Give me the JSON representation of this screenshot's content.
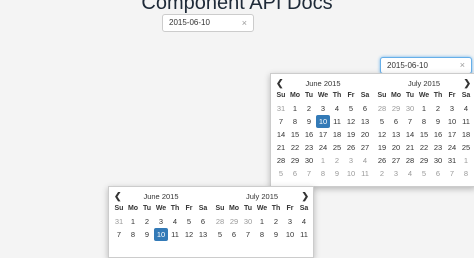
{
  "page": {
    "title": "Component API Docs"
  },
  "input_top": {
    "value": "2015-06-10",
    "clear": "×"
  },
  "input_right": {
    "value": "2015-06-10",
    "clear": "×"
  },
  "weekdays": [
    "Su",
    "Mo",
    "Tu",
    "We",
    "Th",
    "Fr",
    "Sa"
  ],
  "popup1": {
    "prev": "❮",
    "next": "❯",
    "left": {
      "title": "June 2015",
      "days": [
        "31",
        "1",
        "2",
        "3",
        "4",
        "5",
        "6",
        "7",
        "8",
        "9",
        "10",
        "11",
        "12",
        "13",
        "14",
        "15",
        "16",
        "17",
        "18",
        "19",
        "20",
        "21",
        "22",
        "23",
        "24",
        "25",
        "26",
        "27",
        "28",
        "29",
        "30",
        "1",
        "2",
        "3",
        "4",
        "5",
        "6",
        "7",
        "8",
        "9",
        "10",
        "11"
      ],
      "muted": [
        0,
        31,
        32,
        33,
        34,
        35,
        36,
        37,
        38,
        39,
        40,
        41
      ],
      "selected": 10
    },
    "right": {
      "title": "July 2015",
      "days": [
        "28",
        "29",
        "30",
        "1",
        "2",
        "3",
        "4",
        "5",
        "6",
        "7",
        "8",
        "9",
        "10",
        "11",
        "12",
        "13",
        "14",
        "15",
        "16",
        "17",
        "18",
        "19",
        "20",
        "21",
        "22",
        "23",
        "24",
        "25",
        "26",
        "27",
        "28",
        "29",
        "30",
        "31",
        "1",
        "2",
        "3",
        "4",
        "5",
        "6",
        "7",
        "8"
      ],
      "muted": [
        0,
        1,
        2,
        34,
        35,
        36,
        37,
        38,
        39,
        40,
        41
      ],
      "selected": -1
    }
  },
  "popup2": {
    "prev": "❮",
    "next": "❯",
    "left": {
      "title": "June 2015",
      "days": [
        "31",
        "1",
        "2",
        "3",
        "4",
        "5",
        "6",
        "7",
        "8",
        "9",
        "10",
        "11",
        "12",
        "13"
      ],
      "muted": [
        0
      ],
      "selected": 10
    },
    "right": {
      "title": "July 2015",
      "days": [
        "28",
        "29",
        "30",
        "1",
        "2",
        "3",
        "4",
        "5",
        "6",
        "7",
        "8",
        "9",
        "10",
        "11"
      ],
      "muted": [
        0,
        1,
        2
      ],
      "selected": -1
    }
  }
}
